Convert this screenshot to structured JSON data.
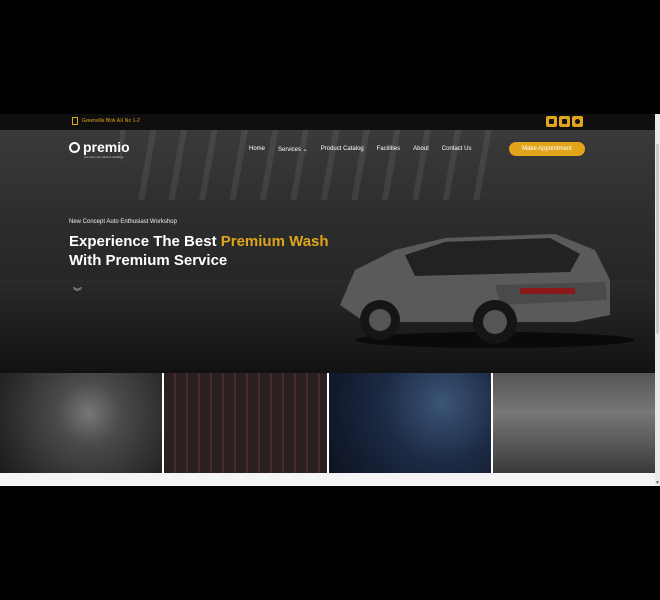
{
  "topbar": {
    "address": "Greenville Blok AX No 1-2",
    "socials": [
      {
        "icon": "facebook-icon"
      },
      {
        "icon": "youtube-icon"
      },
      {
        "icon": "instagram-icon"
      }
    ]
  },
  "nav": {
    "logo_text": "premio",
    "logo_tagline": "premium car wash & detailing",
    "menu": [
      "Home",
      "Services",
      "Product Catalog",
      "Facilities",
      "About",
      "Contact Us"
    ],
    "services_caret": "⌄",
    "cta_label": "Make Appointment"
  },
  "hero": {
    "eyebrow": "New Concept Auto Enthusiast Workshop",
    "headline_part1": "Experience The Best ",
    "headline_highlight": "Premium Wash",
    "headline_part2": "With Premium Service",
    "scroll_glyph": "︾"
  },
  "colors": {
    "accent": "#e0a51a",
    "background": "#1e1e1e"
  }
}
